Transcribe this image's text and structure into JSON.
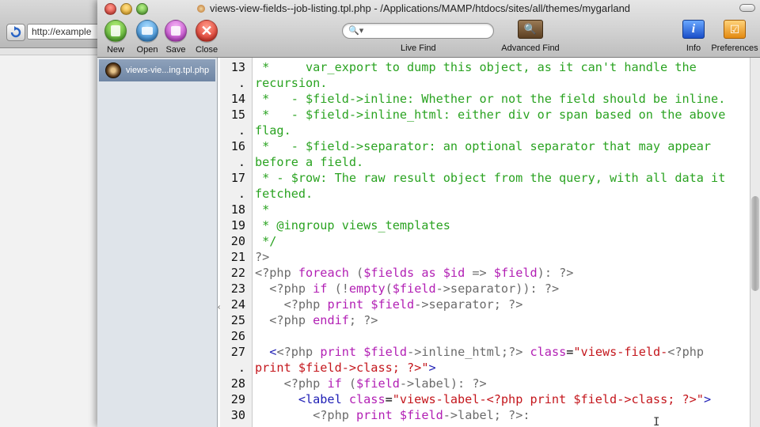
{
  "browser": {
    "url_partial": "http://example"
  },
  "window": {
    "title": "views-view-fields--job-listing.tpl.php - /Applications/MAMP/htdocs/sites/all/themes/mygarland"
  },
  "toolbar": {
    "new_label": "New",
    "open_label": "Open",
    "save_label": "Save",
    "close_label": "Close",
    "search_placeholder": "",
    "live_find_label": "Live Find",
    "advanced_find_label": "Advanced Find",
    "info_label": "Info",
    "preferences_label": "Preferences"
  },
  "sidebar": {
    "document_label": "views-vie...ing.tpl.php"
  },
  "colors": {
    "comment": "#2aa321",
    "keyword": "#b21fb4",
    "variable": "#1f1fb5",
    "string": "#c4161c",
    "delimiter": "#6b6b6b"
  },
  "code": {
    "lines": [
      {
        "num": "13",
        "segs": [
          {
            "t": " *     var_export to dump this object, as it can't handle the",
            "c": "c"
          }
        ]
      },
      {
        "num": ".",
        "segs": [
          {
            "t": "recursion.",
            "c": "c"
          }
        ]
      },
      {
        "num": "14",
        "segs": [
          {
            "t": " *   - $field->inline: Whether or not the field should be inline.",
            "c": "c"
          }
        ]
      },
      {
        "num": "15",
        "segs": [
          {
            "t": " *   - $field->inline_html: either div or span based on the above",
            "c": "c"
          }
        ]
      },
      {
        "num": ".",
        "segs": [
          {
            "t": "flag.",
            "c": "c"
          }
        ]
      },
      {
        "num": "16",
        "segs": [
          {
            "t": " *   - $field->separator: an optional separator that may appear",
            "c": "c"
          }
        ]
      },
      {
        "num": ".",
        "segs": [
          {
            "t": "before a field.",
            "c": "c"
          }
        ]
      },
      {
        "num": "17",
        "segs": [
          {
            "t": " * - $row: The raw result object from the query, with all data it",
            "c": "c"
          }
        ]
      },
      {
        "num": ".",
        "segs": [
          {
            "t": "fetched.",
            "c": "c"
          }
        ]
      },
      {
        "num": "18",
        "segs": [
          {
            "t": " *",
            "c": "c"
          }
        ]
      },
      {
        "num": "19",
        "segs": [
          {
            "t": " * @ingroup views_templates",
            "c": "c"
          }
        ]
      },
      {
        "num": "20",
        "segs": [
          {
            "t": " */",
            "c": "c"
          }
        ]
      },
      {
        "num": "21",
        "segs": [
          {
            "t": "?>",
            "c": "d"
          }
        ]
      },
      {
        "num": "22",
        "segs": [
          {
            "t": "<?php ",
            "c": "d"
          },
          {
            "t": "foreach",
            "c": "k"
          },
          {
            "t": " (",
            "c": "d"
          },
          {
            "t": "$fields",
            "c": "k"
          },
          {
            "t": " as ",
            "c": "k"
          },
          {
            "t": "$id",
            "c": "k"
          },
          {
            "t": " => ",
            "c": "d"
          },
          {
            "t": "$field",
            "c": "k"
          },
          {
            "t": "): ?>",
            "c": "d"
          }
        ]
      },
      {
        "num": "23",
        "segs": [
          {
            "t": "  <?php ",
            "c": "d"
          },
          {
            "t": "if",
            "c": "k"
          },
          {
            "t": " (!",
            "c": "d"
          },
          {
            "t": "empty",
            "c": "k"
          },
          {
            "t": "(",
            "c": "d"
          },
          {
            "t": "$field",
            "c": "k"
          },
          {
            "t": "->separator)): ?>",
            "c": "d"
          }
        ]
      },
      {
        "num": "24",
        "segs": [
          {
            "t": "    <?php ",
            "c": "d"
          },
          {
            "t": "print",
            "c": "k"
          },
          {
            "t": " ",
            "c": "d"
          },
          {
            "t": "$field",
            "c": "k"
          },
          {
            "t": "->separator; ?>",
            "c": "d"
          }
        ]
      },
      {
        "num": "25",
        "segs": [
          {
            "t": "  <?php ",
            "c": "d"
          },
          {
            "t": "endif",
            "c": "k"
          },
          {
            "t": "; ?>",
            "c": "d"
          }
        ]
      },
      {
        "num": "26",
        "segs": [
          {
            "t": "",
            "c": "d"
          }
        ]
      },
      {
        "num": "27",
        "segs": [
          {
            "t": "  <",
            "c": "v"
          },
          {
            "t": "<?php ",
            "c": "d"
          },
          {
            "t": "print",
            "c": "k"
          },
          {
            "t": " ",
            "c": "d"
          },
          {
            "t": "$field",
            "c": "k"
          },
          {
            "t": "->inline_html;?>",
            "c": "d"
          },
          {
            "t": " class",
            "c": "k"
          },
          {
            "t": "=",
            "c": "p"
          },
          {
            "t": "\"views-field-",
            "c": "s"
          },
          {
            "t": "<?php",
            "c": "d"
          }
        ]
      },
      {
        "num": ".",
        "segs": [
          {
            "t": "print $field->class; ?>",
            "c": "s"
          },
          {
            "t": "\"",
            "c": "s"
          },
          {
            "t": ">",
            "c": "v"
          }
        ]
      },
      {
        "num": "28",
        "segs": [
          {
            "t": "    <?php ",
            "c": "d"
          },
          {
            "t": "if",
            "c": "k"
          },
          {
            "t": " (",
            "c": "d"
          },
          {
            "t": "$field",
            "c": "k"
          },
          {
            "t": "->label): ?>",
            "c": "d"
          }
        ]
      },
      {
        "num": "29",
        "segs": [
          {
            "t": "      <label ",
            "c": "v"
          },
          {
            "t": "class",
            "c": "k"
          },
          {
            "t": "=",
            "c": "p"
          },
          {
            "t": "\"views-label-<?php print $field->class; ?>\"",
            "c": "s"
          },
          {
            "t": ">",
            "c": "v"
          }
        ]
      },
      {
        "num": "30",
        "segs": [
          {
            "t": "        <?php ",
            "c": "d"
          },
          {
            "t": "print",
            "c": "k"
          },
          {
            "t": " ",
            "c": "d"
          },
          {
            "t": "$field",
            "c": "k"
          },
          {
            "t": "->label; ?>:",
            "c": "d"
          }
        ]
      }
    ]
  }
}
